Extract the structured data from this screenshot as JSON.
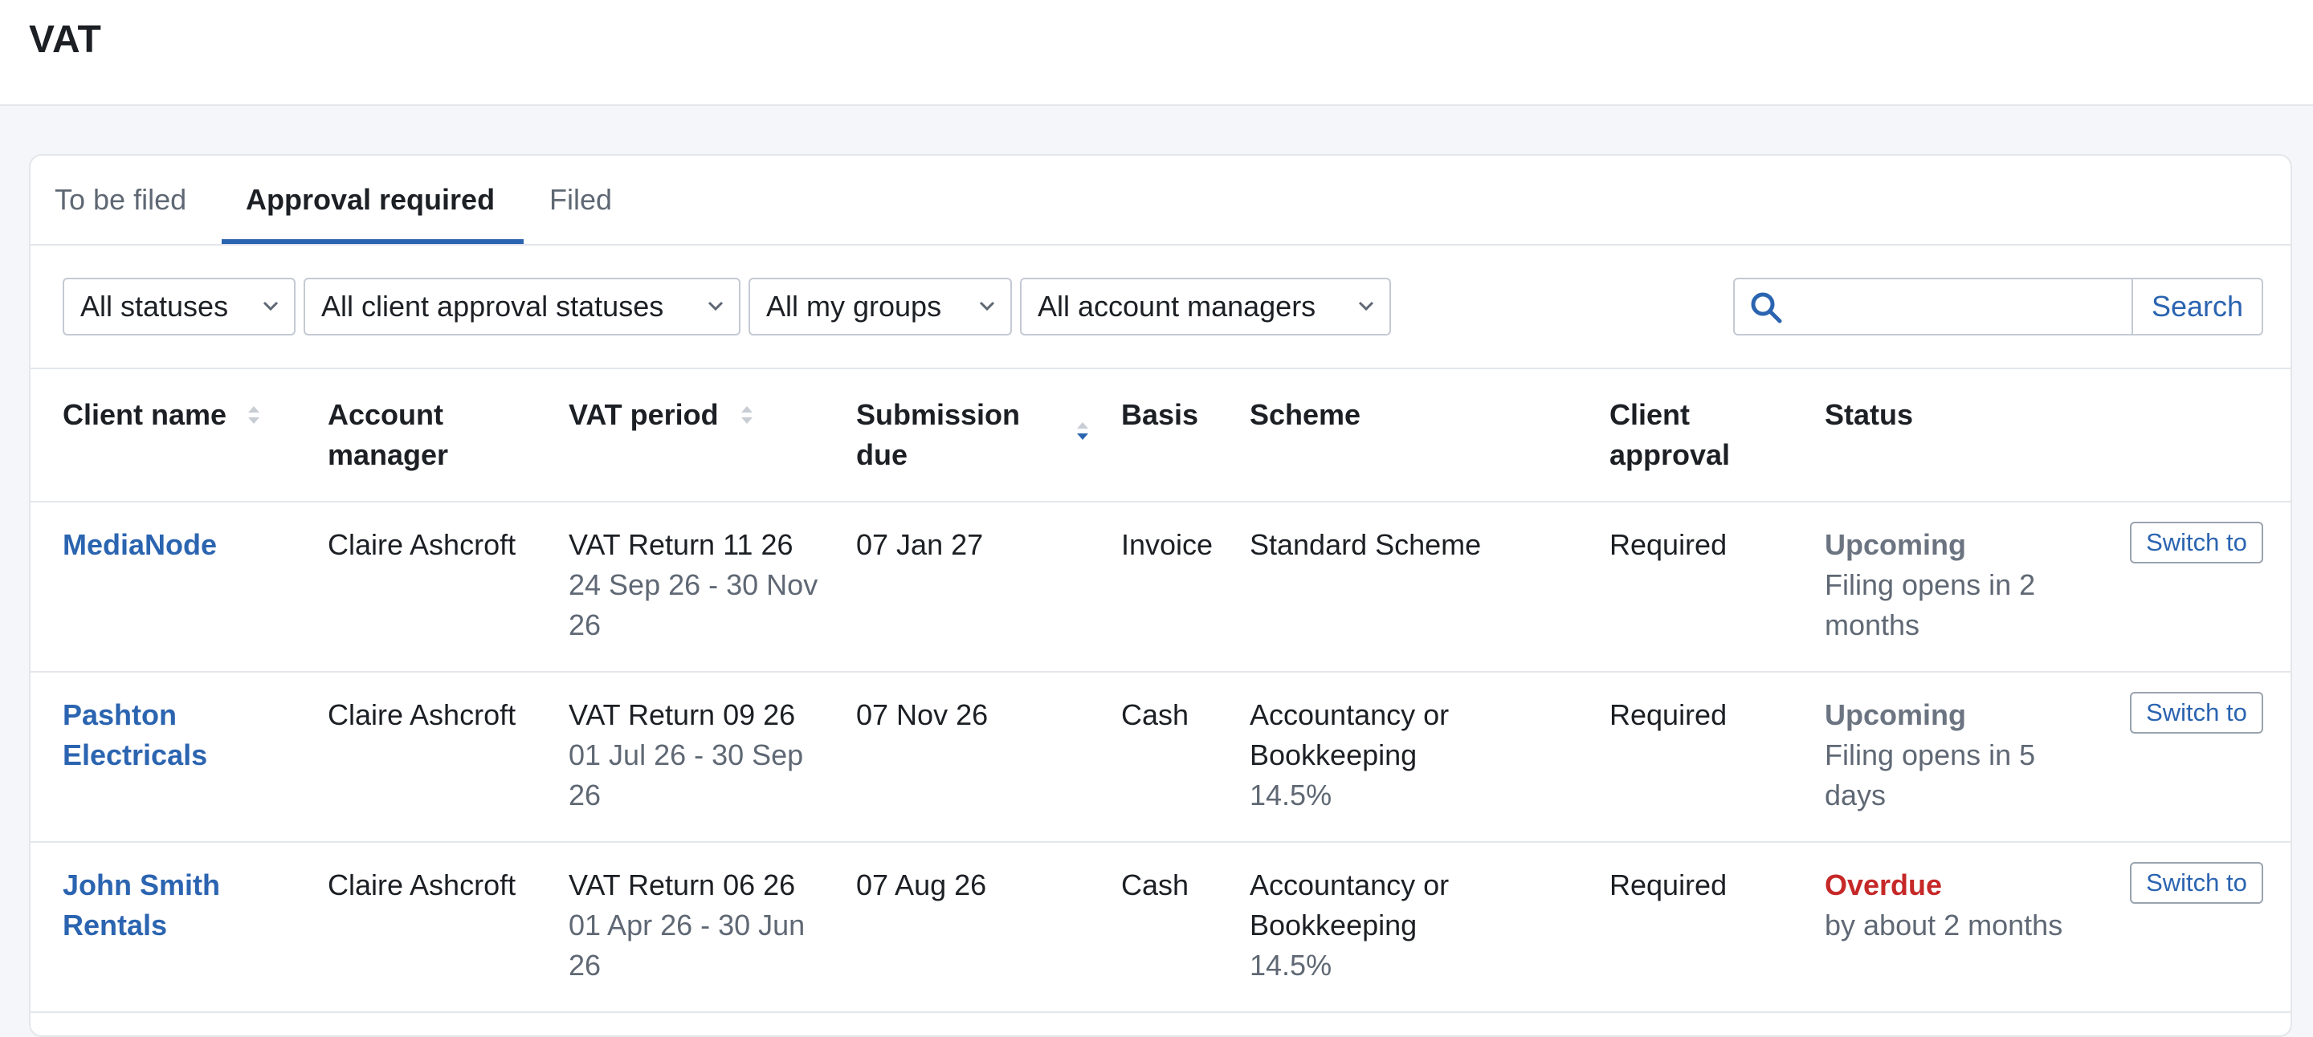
{
  "page": {
    "title": "VAT"
  },
  "tabs": [
    {
      "label": "To be filed",
      "active": false
    },
    {
      "label": "Approval required",
      "active": true
    },
    {
      "label": "Filed",
      "active": false
    }
  ],
  "filters": {
    "status": "All statuses",
    "client_approval": "All client approval statuses",
    "groups": "All my groups",
    "account_managers": "All account managers"
  },
  "search": {
    "value": "",
    "button_label": "Search"
  },
  "table": {
    "columns": {
      "client_name": "Client name",
      "account_manager": "Account manager",
      "vat_period": "VAT period",
      "submission_due": "Submission due",
      "basis": "Basis",
      "scheme": "Scheme",
      "client_approval": "Client approval",
      "status": "Status"
    },
    "rows": [
      {
        "client_name": "MediaNode",
        "account_manager": "Claire Ashcroft",
        "vat_return": "VAT Return 11 26",
        "vat_dates": "24 Sep 26 - 30 Nov 26",
        "submission_due": "07 Jan 27",
        "basis": "Invoice",
        "scheme": "Standard Scheme",
        "scheme_rate": "",
        "client_approval": "Required",
        "status": "Upcoming",
        "status_detail": "Filing opens in 2 months",
        "action_label": "Switch to"
      },
      {
        "client_name": "Pashton Electricals",
        "account_manager": "Claire Ashcroft",
        "vat_return": "VAT Return 09 26",
        "vat_dates": "01 Jul 26 - 30 Sep 26",
        "submission_due": "07 Nov 26",
        "basis": "Cash",
        "scheme": "Accountancy or Bookkeeping",
        "scheme_rate": "14.5%",
        "client_approval": "Required",
        "status": "Upcoming",
        "status_detail": "Filing opens in 5 days",
        "action_label": "Switch to"
      },
      {
        "client_name": "John Smith Rentals",
        "account_manager": "Claire Ashcroft",
        "vat_return": "VAT Return 06 26",
        "vat_dates": "01 Apr 26 - 30 Jun 26",
        "submission_due": "07 Aug 26",
        "basis": "Cash",
        "scheme": "Accountancy or Bookkeeping",
        "scheme_rate": "14.5%",
        "client_approval": "Required",
        "status": "Overdue",
        "status_detail": "by about 2 months",
        "action_label": "Switch to"
      }
    ]
  },
  "colors": {
    "accent": "#2b64b0",
    "overdue": "#c62828",
    "muted": "#5f6874"
  }
}
